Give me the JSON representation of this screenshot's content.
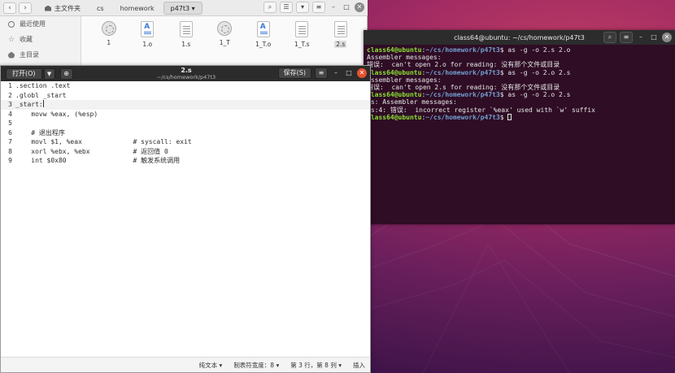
{
  "colors": {
    "terminal_bg": "#2f0d25",
    "prompt_user": "#8ae234",
    "prompt_path": "#729fcf",
    "close_red": "#e5512f"
  },
  "file_manager": {
    "breadcrumbs": [
      "主文件夹",
      "cs",
      "homework",
      "p47t3"
    ],
    "sidebar": [
      {
        "label": "最近使用",
        "icon": "clock-icon"
      },
      {
        "label": "收藏",
        "icon": "star-icon"
      },
      {
        "label": "主目录",
        "icon": "home-icon"
      }
    ],
    "files": [
      {
        "name": "1",
        "kind": "exe"
      },
      {
        "name": "1.o",
        "kind": "obj"
      },
      {
        "name": "1.s",
        "kind": "txt"
      },
      {
        "name": "1_T",
        "kind": "exe"
      },
      {
        "name": "1_T.o",
        "kind": "obj"
      },
      {
        "name": "1_T.s",
        "kind": "txt"
      },
      {
        "name": "2.s",
        "kind": "txt",
        "selected": true
      }
    ]
  },
  "terminal": {
    "title": "class64@ubuntu: ~/cs/homework/p47t3",
    "prompt_user": "class64@ubuntu",
    "prompt_path": "~/cs/homework/p47t3",
    "lines": [
      {
        "type": "cmd",
        "text": "as -g -o 2.s 2.o"
      },
      {
        "type": "out",
        "text": "Assembler messages:"
      },
      {
        "type": "out",
        "text": "错误:  can't open 2.o for reading: 没有那个文件或目录"
      },
      {
        "type": "cmd",
        "text": "as -g -o 2.o 2.s"
      },
      {
        "type": "out",
        "text": "Assembler messages:"
      },
      {
        "type": "out",
        "text": "错误:  can't open 2.s for reading: 没有那个文件或目录"
      },
      {
        "type": "cmd",
        "text": "as -g -o 2.o 2.s"
      },
      {
        "type": "out",
        "text": ".s: Assembler messages:"
      },
      {
        "type": "out",
        "text": ".s:4: 错误:  incorrect register `%eax' used with `w' suffix"
      },
      {
        "type": "prompt",
        "text": ""
      }
    ]
  },
  "editor": {
    "open_label": "打开(O)",
    "save_label": "保存(S)",
    "title": "2.s",
    "subtitle": "~/cs/homework/p47t3",
    "lines": [
      {
        "n": "1",
        "text": ".section .text"
      },
      {
        "n": "2",
        "text": ".globl _start"
      },
      {
        "n": "3",
        "text": "_start:",
        "current": true
      },
      {
        "n": "4",
        "text": "    movw %eax, (%esp)"
      },
      {
        "n": "5",
        "text": ""
      },
      {
        "n": "6",
        "text": "    # 退出程序"
      },
      {
        "n": "7",
        "text": "    movl $1, %eax             # syscall: exit"
      },
      {
        "n": "8",
        "text": "    xorl %ebx, %ebx           # 返回值 0"
      },
      {
        "n": "9",
        "text": "    int $0x80                 # 触发系统调用"
      }
    ],
    "status": {
      "syntax": "纯文本",
      "tab_width": "制表符宽度：8",
      "position": "第 3 行，第 8 列",
      "mode": "插入"
    }
  }
}
